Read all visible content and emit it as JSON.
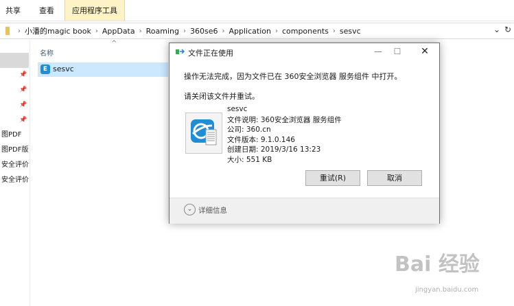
{
  "ribbon": {
    "tabs": [
      "共享",
      "查看",
      "应用程序工具"
    ]
  },
  "address": {
    "path": [
      "小潘的magic book",
      "AppData",
      "Roaming",
      "360se6",
      "Application",
      "components",
      "sesvc"
    ]
  },
  "nav": {
    "items": [
      "图PDF",
      "图PDF版",
      "安全评价",
      "安全评价"
    ]
  },
  "list": {
    "column_name": "名称",
    "file_name": "sesvc"
  },
  "dialog": {
    "title": "文件正在使用",
    "message": "操作无法完成，因为文件已在 360安全浏览器 服务组件 中打开。",
    "instruction": "请关闭该文件并重试。",
    "file": {
      "name": "sesvc",
      "description": "文件说明: 360安全浏览器 服务组件",
      "company": "公司: 360.cn",
      "version": "文件版本: 9.1.0.146",
      "created": "创建日期: 2019/3/16 13:23",
      "size": "大小: 551 KB"
    },
    "retry_label": "重试(R)",
    "cancel_label": "取消",
    "more_info_label": "详细信息"
  },
  "watermark": {
    "logo_text": "Bai 经验",
    "url": "jingyan.baidu.com"
  },
  "colors": {
    "selection": "#cce8ff",
    "active_tab": "#fdf3c7",
    "accent": "#1e8fd6"
  }
}
